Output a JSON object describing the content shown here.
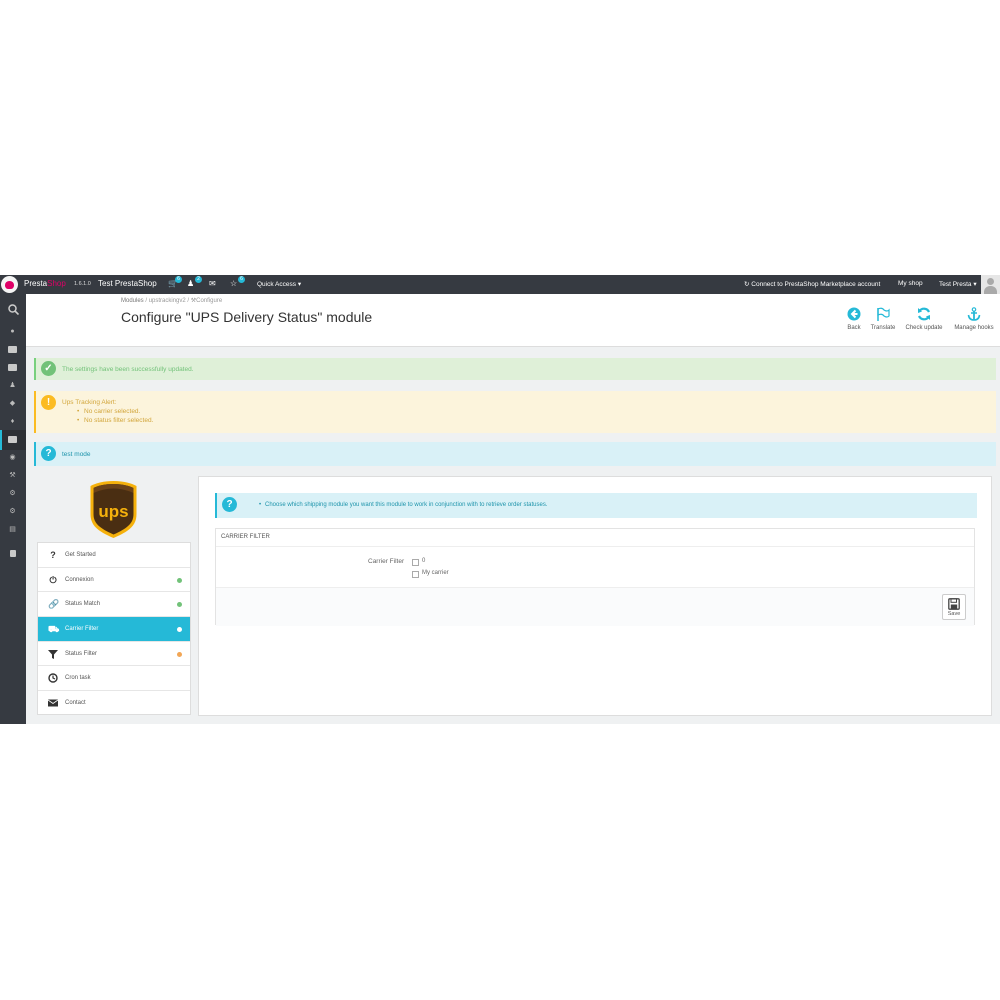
{
  "topbar": {
    "brand_a": "Presta",
    "brand_b": "Shop",
    "version": "1.6.1.0",
    "shop_name": "Test PrestaShop",
    "badges": {
      "orders": "6",
      "customers": "2",
      "messages": "",
      "trophy": "6"
    },
    "quick_access": "Quick Access",
    "connect": "Connect to PrestaShop Marketplace account",
    "my_shop": "My shop",
    "user": "Test Presta"
  },
  "breadcrumb": {
    "item1": "Modules",
    "item2": "upstrackingv2",
    "item3": "Configure"
  },
  "page_title": "Configure \"UPS Delivery Status\" module",
  "toolbar": {
    "back": "Back",
    "translate": "Translate",
    "check_update": "Check update",
    "manage_hooks": "Manage hooks"
  },
  "alerts": {
    "success": "The settings have been successfully updated.",
    "warning_title": "Ups Tracking Alert:",
    "warning_items": [
      "No carrier selected.",
      "No status filter selected."
    ],
    "info": "test mode"
  },
  "module_nav": [
    {
      "label": "Get Started",
      "icon": "question-icon",
      "dot": ""
    },
    {
      "label": "Connexion",
      "icon": "power-icon",
      "dot": "#72c279"
    },
    {
      "label": "Status Match",
      "icon": "link-icon",
      "dot": "#72c279"
    },
    {
      "label": "Carrier Filter",
      "icon": "truck-icon",
      "dot": "#ffffff"
    },
    {
      "label": "Status Filter",
      "icon": "filter-icon",
      "dot": "#f2a655"
    },
    {
      "label": "Cron task",
      "icon": "clock-icon",
      "dot": ""
    },
    {
      "label": "Contact",
      "icon": "envelope-icon",
      "dot": ""
    }
  ],
  "content": {
    "info": "Choose which shipping module you want this module to work in conjunction with to retrieve order statuses.",
    "panel_title": "CARRIER FILTER",
    "field_label": "Carrier Filter",
    "options": [
      "0",
      "My carrier"
    ],
    "save": "Save"
  },
  "colors": {
    "accent": "#25b9d7",
    "success": "#72c279",
    "warning": "#fbbb22",
    "topbar": "#363a41",
    "brand": "#df0067"
  }
}
